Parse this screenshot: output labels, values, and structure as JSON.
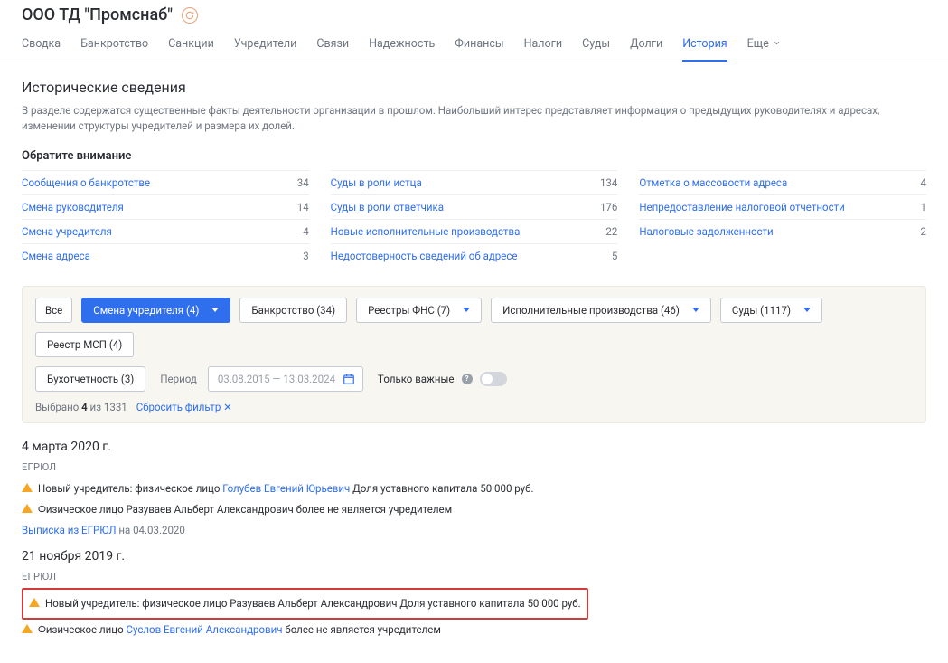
{
  "header": {
    "title": "ООО ТД \"Промснаб\""
  },
  "tabs": {
    "items": [
      {
        "label": "Сводка"
      },
      {
        "label": "Банкротство"
      },
      {
        "label": "Санкции"
      },
      {
        "label": "Учредители"
      },
      {
        "label": "Связи"
      },
      {
        "label": "Надежность"
      },
      {
        "label": "Финансы"
      },
      {
        "label": "Налоги"
      },
      {
        "label": "Суды"
      },
      {
        "label": "Долги"
      },
      {
        "label": "История"
      },
      {
        "label": "Еще"
      }
    ],
    "active_index": 10
  },
  "section": {
    "title": "Исторические сведения",
    "desc": "В разделе содержатся существенные факты деятельности организации в прошлом. Наибольший интерес представляет информация о предыдущих руководителях и адресах, изменении структуры учредителей и размера их долей."
  },
  "attention": {
    "title": "Обратите внимание",
    "cols": [
      [
        {
          "label": "Сообщения о банкротстве",
          "count": "34"
        },
        {
          "label": "Смена руководителя",
          "count": "14"
        },
        {
          "label": "Смена учредителя",
          "count": "4"
        },
        {
          "label": "Смена адреса",
          "count": "3"
        }
      ],
      [
        {
          "label": "Суды в роли истца",
          "count": "134"
        },
        {
          "label": "Суды в роли ответчика",
          "count": "176"
        },
        {
          "label": "Новые исполнительные производства",
          "count": "22"
        },
        {
          "label": "Недостоверность сведений об адресе",
          "count": "5"
        }
      ],
      [
        {
          "label": "Отметка о массовости адреса",
          "count": "4"
        },
        {
          "label": "Непредоставление налоговой отчетности",
          "count": "1"
        },
        {
          "label": "Налоговые задолженности",
          "count": "2"
        }
      ]
    ]
  },
  "filters": {
    "all": "Все",
    "chips": [
      {
        "label": "Смена учредителя (4)",
        "active": true,
        "dropdown": true
      },
      {
        "label": "Банкротство (34)",
        "dropdown": false
      },
      {
        "label": "Реестры ФНС (7)",
        "dropdown": true
      },
      {
        "label": "Исполнительные производства (46)",
        "dropdown": true
      },
      {
        "label": "Суды (1117)",
        "dropdown": true
      },
      {
        "label": "Реестр МСП (4)",
        "dropdown": false
      }
    ],
    "row2": [
      {
        "label": "Бухотчетность (3)",
        "dropdown": false
      }
    ],
    "period_label": "Период",
    "date_range": "03.08.2015 — 13.03.2024",
    "only_important": "Только важные",
    "selected_prefix": "Выбрано ",
    "selected_bold": "4",
    "selected_mid": " из ",
    "selected_total": "1331",
    "reset": "Сбросить фильтр ✕"
  },
  "events": [
    {
      "date": "4 марта 2020 г.",
      "source": "ЕГРЮЛ",
      "lines": [
        {
          "pre": "Новый учредитель: физическое лицо ",
          "link": "Голубев Евгений Юрьевич",
          "post": " Доля уставного капитала 50 000 руб.",
          "highlight": false
        },
        {
          "pre": "Физическое лицо Разуваев Альберт Александрович более не является учредителем",
          "link": "",
          "post": "",
          "highlight": false
        }
      ],
      "extract_link": "Выписка из ЕГРЮЛ",
      "extract_suffix": " на 04.03.2020"
    },
    {
      "date": "21 ноября 2019 г.",
      "source": "ЕГРЮЛ",
      "lines": [
        {
          "pre": "Новый учредитель: физическое лицо Разуваев Альберт Александрович Доля уставного капитала 50 000 руб.",
          "link": "",
          "post": "",
          "highlight": true
        },
        {
          "pre": "Физическое лицо ",
          "link": "Суслов Евгений Александрович",
          "post": " более не является учредителем",
          "highlight": false
        }
      ]
    }
  ]
}
